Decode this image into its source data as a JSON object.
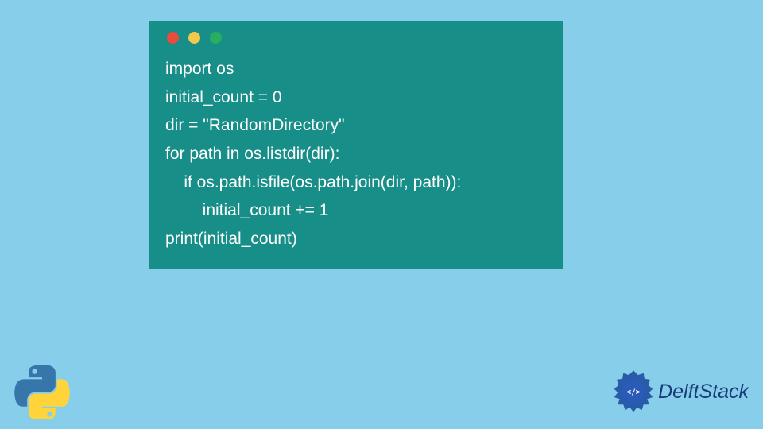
{
  "code": {
    "lines": [
      "import os",
      "initial_count = 0",
      "dir = \"RandomDirectory\"",
      "for path in os.listdir(dir):",
      "    if os.path.isfile(os.path.join(dir, path)):",
      "        initial_count += 1",
      "print(initial_count)"
    ]
  },
  "window": {
    "dots": [
      "#e94b3c",
      "#f2c94c",
      "#27ae60"
    ]
  },
  "branding": {
    "delftstack_label": "DelftStack"
  },
  "colors": {
    "background": "#87ceeb",
    "code_window": "#178e87",
    "code_text": "#ffffff",
    "brand_blue": "#1a3a7a"
  }
}
